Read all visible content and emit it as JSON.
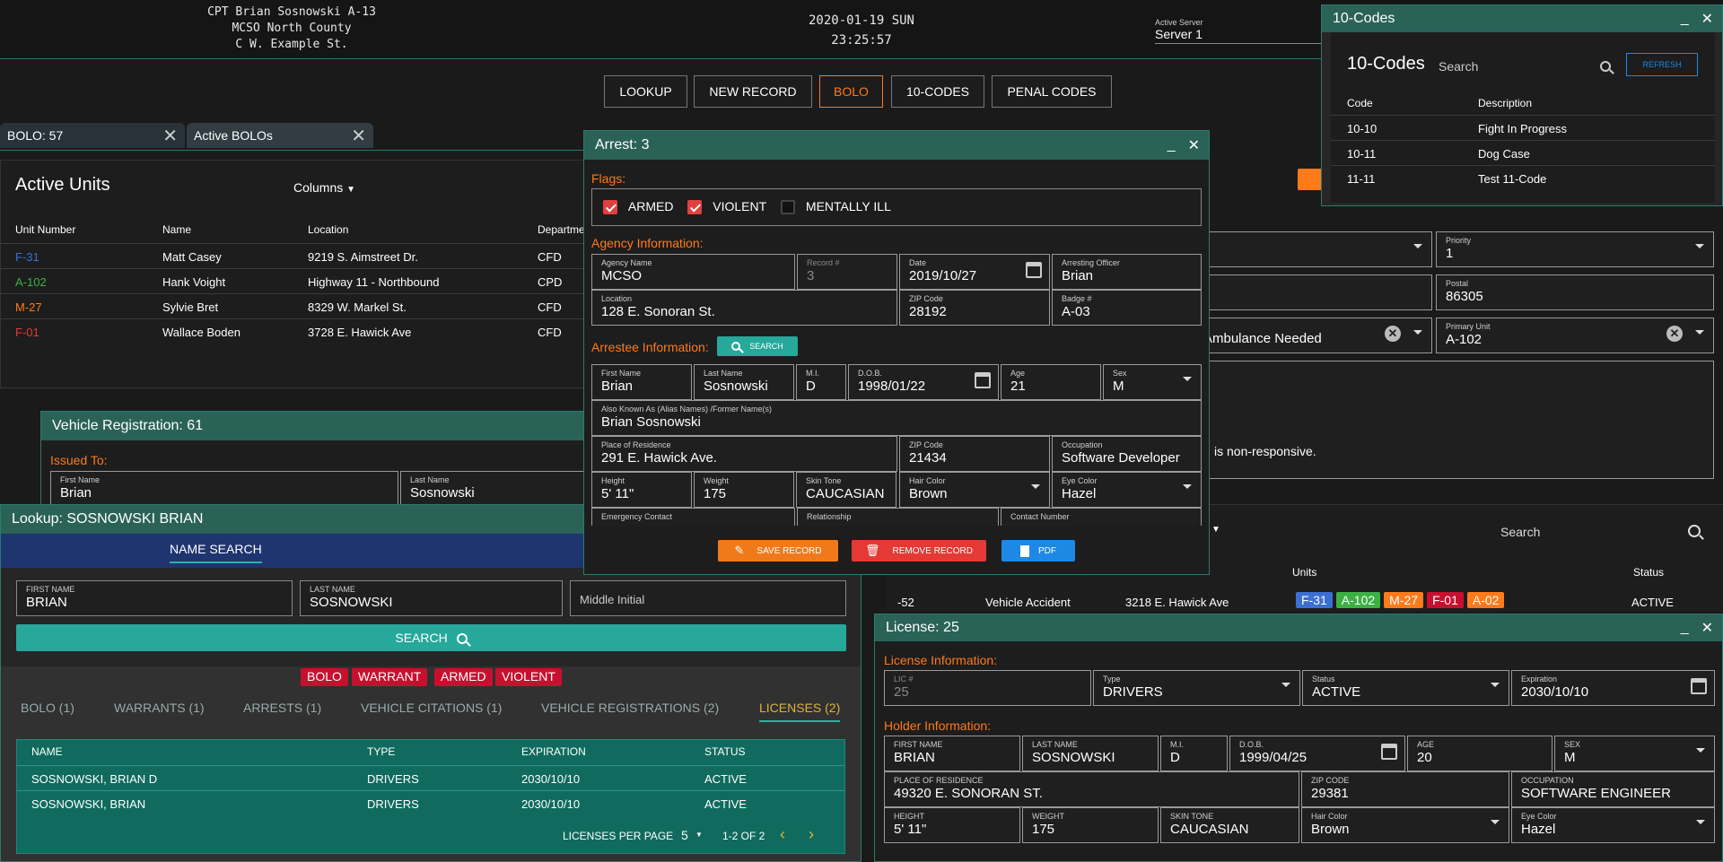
{
  "header": {
    "officer": "CPT Brian Sosnowski A-13",
    "agency": "MCSO North County",
    "street": "C W. Example St.",
    "date": "2020-01-19 SUN",
    "time": "23:25:57",
    "server_label": "Active Server",
    "server": "Server 1"
  },
  "nav": {
    "lookup": "LOOKUP",
    "new_record": "NEW RECORD",
    "bolo": "BOLO",
    "ten_codes": "10-CODES",
    "penal_codes": "PENAL CODES"
  },
  "tabs": {
    "bolo": "BOLO: 57",
    "active_bolos": "Active BOLOs"
  },
  "active_units": {
    "title": "Active Units",
    "columns_label": "Columns",
    "headers": {
      "unit": "Unit Number",
      "name": "Name",
      "location": "Location",
      "department": "Departme"
    },
    "rows": [
      {
        "unit": "F-31",
        "unit_color": "#3b6fd6",
        "name": "Matt Casey",
        "location": "9219 S. Aimstreet Dr.",
        "dept": "CFD"
      },
      {
        "unit": "A-102",
        "unit_color": "#3bb143",
        "name": "Hank Voight",
        "location": "Highway 11 - Northbound",
        "dept": "CPD"
      },
      {
        "unit": "M-27",
        "unit_color": "#ff7a1a",
        "name": "Sylvie Bret",
        "location": "8329 W. Markel St.",
        "dept": "CFD"
      },
      {
        "unit": "F-01",
        "unit_color": "#e53935",
        "name": "Wallace Boden",
        "location": "3728 E. Hawick Ave",
        "dept": "CFD"
      }
    ]
  },
  "vehicle_reg": {
    "title": "Vehicle Registration: 61",
    "issued_to": "Issued To:",
    "first_name_label": "First Name",
    "first_name": "Brian",
    "last_name_label": "Last Name",
    "last_name": "Sosnowski"
  },
  "lookup": {
    "title": "Lookup: SOSNOWSKI BRIAN",
    "name_search": "NAME SEARCH",
    "first_label": "FIRST NAME",
    "first": "BRIAN",
    "last_label": "LAST NAME",
    "last": "SOSNOWSKI",
    "mi_placeholder": "Middle Initial",
    "search": "SEARCH",
    "flags": [
      "BOLO",
      "WARRANT",
      "ARMED",
      "VIOLENT"
    ],
    "tabs": [
      "BOLO (1)",
      "WARRANTS (1)",
      "ARRESTS (1)",
      "VEHICLE CITATIONS (1)",
      "VEHICLE REGISTRATIONS (2)",
      "LICENSES (2)"
    ],
    "table_headers": {
      "name": "NAME",
      "type": "TYPE",
      "expiration": "EXPIRATION",
      "status": "STATUS"
    },
    "rows": [
      {
        "name": "SOSNOWSKI, BRIAN D",
        "type": "DRIVERS",
        "expiration": "2030/10/10",
        "status": "ACTIVE"
      },
      {
        "name": "SOSNOWSKI, BRIAN",
        "type": "DRIVERS",
        "expiration": "2030/10/10",
        "status": "ACTIVE"
      }
    ],
    "per_page_label": "LICENSES PER PAGE",
    "per_page": "5",
    "range": "1-2 OF 2"
  },
  "arrest": {
    "title": "Arrest: 3",
    "flags_label": "Flags:",
    "flags": [
      {
        "label": "ARMED",
        "checked": true
      },
      {
        "label": "VIOLENT",
        "checked": true
      },
      {
        "label": "MENTALLY ILL",
        "checked": false
      }
    ],
    "agency_section": "Agency Information:",
    "agency_name_label": "Agency Name",
    "agency_name": "MCSO",
    "record_label": "Record #",
    "record": "3",
    "date_label": "Date",
    "date": "2019/10/27",
    "officer_label": "Arresting Officer",
    "officer": "Brian",
    "location_label": "Location",
    "location": "128 E. Sonoran St.",
    "zip_label": "ZIP Code",
    "zip": "28192",
    "badge_label": "Badge #",
    "badge": "A-03",
    "arrestee_section": "Arrestee Information:",
    "search": "SEARCH",
    "first_label": "First Name",
    "first": "Brian",
    "last_label": "Last Name",
    "last": "Sosnowski",
    "mi_label": "M.I.",
    "mi": "D",
    "dob_label": "D.O.B.",
    "dob": "1998/01/22",
    "age_label": "Age",
    "age": "21",
    "sex_label": "Sex",
    "sex": "M",
    "aka_label": "Also Known As (Alias Names) /Former Name(s)",
    "aka": "Brian Sosnowski",
    "residence_label": "Place of Residence",
    "residence": "291 E. Hawick Ave.",
    "zip2_label": "ZIP Code",
    "zip2": "21434",
    "occupation_label": "Occupation",
    "occupation": "Software Developer",
    "height_label": "Height",
    "height": "5' 11\"",
    "weight_label": "Weight",
    "weight": "175",
    "skin_label": "Skin Tone",
    "skin": "CAUCASIAN",
    "hair_label": "Hair Color",
    "hair": "Brown",
    "eye_label": "Eye Color",
    "eye": "Hazel",
    "emergency_label": "Emergency Contact",
    "relationship_label": "Relationship",
    "contact_label": "Contact Number",
    "save": "SAVE RECORD",
    "remove": "REMOVE RECORD",
    "pdf": "PDF"
  },
  "ten_codes": {
    "title": "10-Codes",
    "heading": "10-Codes",
    "search_placeholder": "Search",
    "refresh": "REFRESH",
    "code_header": "Code",
    "desc_header": "Description",
    "rows": [
      {
        "code": "10-10",
        "desc": "Fight In Progress"
      },
      {
        "code": "10-11",
        "desc": "Dog Case"
      },
      {
        "code": "11-11",
        "desc": "Test 11-Code"
      }
    ]
  },
  "call": {
    "priority_label": "Priority",
    "priority": "1",
    "postal_label": "Postal",
    "postal": "86305",
    "ambulance": "Ambulance Needed",
    "primary_unit_label": "Primary Unit",
    "primary_unit": "A-102",
    "notes": "is non-responsive."
  },
  "calls_list": {
    "search": "Search",
    "units_header": "Units",
    "status_header": "Status",
    "row": {
      "id": "-52",
      "type": "Vehicle Accident",
      "address": "3218 E. Hawick Ave",
      "status": "ACTIVE",
      "units": [
        {
          "label": "F-31",
          "color": "#3b6fd6"
        },
        {
          "label": "A-102",
          "color": "#3bb143"
        },
        {
          "label": "M-27",
          "color": "#ff7a1a"
        },
        {
          "label": "F-01",
          "color": "#c8102e"
        },
        {
          "label": "A-02",
          "color": "#ff7a1a"
        }
      ]
    }
  },
  "license": {
    "title": "License: 25",
    "info_section": "License Information:",
    "lic_label": "LIC #",
    "lic": "25",
    "type_label": "Type",
    "type": "DRIVERS",
    "status_label": "Status",
    "status": "ACTIVE",
    "exp_label": "Expiration",
    "exp": "2030/10/10",
    "holder_section": "Holder Information:",
    "first_label": "FIRST NAME",
    "first": "BRIAN",
    "last_label": "LAST NAME",
    "last": "SOSNOWSKI",
    "mi_label": "M.I.",
    "mi": "D",
    "dob_label": "D.O.B.",
    "dob": "1999/04/25",
    "age_label": "AGE",
    "age": "20",
    "sex_label": "SEX",
    "sex": "M",
    "residence_label": "PLACE OF RESIDENCE",
    "residence": "49320 E. SONORAN ST.",
    "zip_label": "ZIP CODE",
    "zip": "29381",
    "occupation_label": "OCCUPATION",
    "occupation": "SOFTWARE ENGINEER",
    "height_label": "HEIGHT",
    "height": "5' 11\"",
    "weight_label": "WEIGHT",
    "weight": "175",
    "skin_label": "SKIN TONE",
    "skin": "CAUCASIAN",
    "hair_label": "Hair Color",
    "hair": "Brown",
    "eye_label": "Eye Color",
    "eye": "Hazel"
  }
}
